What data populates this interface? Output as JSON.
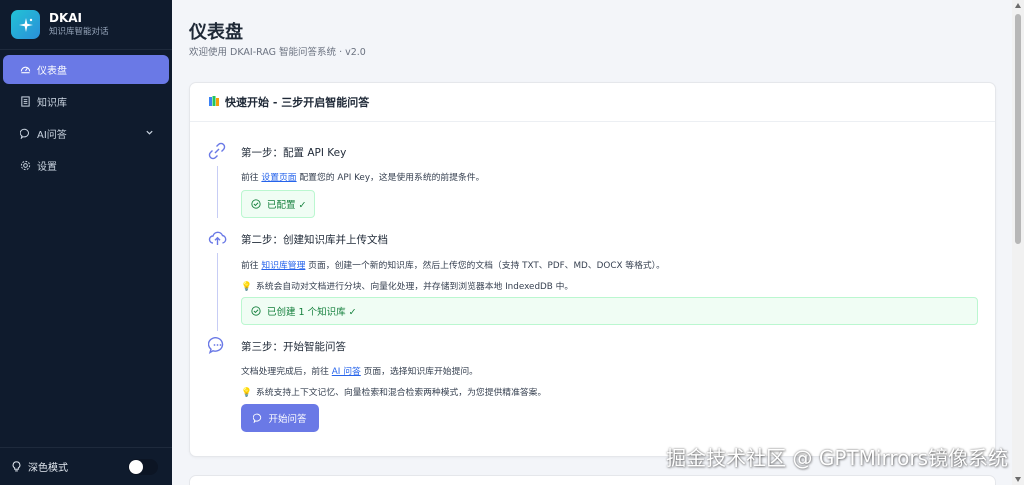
{
  "brand": {
    "title": "DKAI",
    "subtitle": "知识库智能对话"
  },
  "sidebar": {
    "items": [
      {
        "label": "仪表盘",
        "icon": "dashboard-icon",
        "active": true
      },
      {
        "label": "知识库",
        "icon": "document-icon"
      },
      {
        "label": "AI问答",
        "icon": "chat-icon",
        "expandable": true
      },
      {
        "label": "设置",
        "icon": "gear-icon"
      }
    ],
    "footer": {
      "label": "深色模式",
      "icon": "lightbulb-icon",
      "toggle_on": false
    }
  },
  "main": {
    "title": "仪表盘",
    "subtitle": "欢迎使用 DKAI-RAG 智能问答系统 · v2.0",
    "quickstart": {
      "title": "快速开始 - 三步开启智能问答",
      "steps": [
        {
          "title": "第一步：配置 API Key",
          "desc_prefix": "前往 ",
          "desc_link": "设置页面",
          "desc_suffix": " 配置您的 API Key，这是使用系统的前提条件。",
          "badge": "已配置 ✓"
        },
        {
          "title": "第二步：创建知识库并上传文档",
          "desc_prefix": "前往 ",
          "desc_link": "知识库管理",
          "desc_suffix": " 页面，创建一个新的知识库，然后上传您的文档（支持 TXT、PDF、MD、DOCX 等格式）。",
          "hint": "系统会自动对文档进行分块、向量化处理，并存储到浏览器本地 IndexedDB 中。",
          "badge": "已创建 1 个知识库 ✓"
        },
        {
          "title": "第三步：开始智能问答",
          "desc_prefix": "文档处理完成后，前往 ",
          "desc_link": "AI 问答",
          "desc_suffix": " 页面，选择知识库开始提问。",
          "hint": "系统支持上下文记忆、向量检索和混合检索两种模式，为您提供精准答案。",
          "button": "开始问答"
        }
      ]
    }
  },
  "watermark": "掘金技术社区 @ GPTMirrors镜像系统",
  "colors": {
    "sidebar_bg": "#0f1b2d",
    "accent": "#6a79e6",
    "success": "#15803d",
    "link": "#2563eb"
  }
}
